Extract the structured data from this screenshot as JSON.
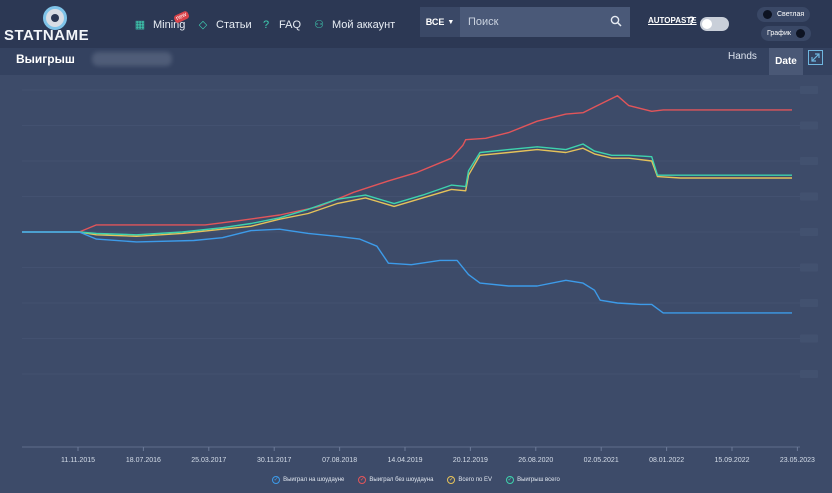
{
  "header": {
    "logo_text": "STATNAME",
    "nav": [
      {
        "label": "Mining",
        "icon": "mining-icon",
        "glyph": "▦",
        "badge": "new"
      },
      {
        "label": "Статьи",
        "icon": "diamond-icon",
        "glyph": "◇"
      },
      {
        "label": "FAQ",
        "icon": "help-circle-icon",
        "glyph": "?"
      },
      {
        "label": "Мой аккаунт",
        "icon": "user-icon",
        "glyph": "⚇"
      }
    ],
    "search": {
      "scope": "ВСЕ",
      "placeholder": "Поиск",
      "value": ""
    },
    "autopaste_label": "AUTOPASTE",
    "help_glyph": "?",
    "theme_label": "Светлая",
    "chart_label": "График"
  },
  "subheader": {
    "title": "Выигрыш",
    "hands_label": "Hands",
    "date_label": "Date"
  },
  "colors": {
    "blue": "#3d9be9",
    "red": "#e2555a",
    "yellow": "#e5c25a",
    "green": "#3ed3ad",
    "accent": "#3fd0b3"
  },
  "chart_data": {
    "type": "line",
    "x_ticks": [
      "11.11.2015",
      "18.07.2016",
      "25.03.2017",
      "30.11.2017",
      "07.08.2018",
      "14.04.2019",
      "20.12.2019",
      "26.08.2020",
      "02.05.2021",
      "08.01.2022",
      "15.09.2022",
      "23.05.2023",
      "28.01.2024",
      "04.10.2024"
    ],
    "x_range": [
      0,
      13.45
    ],
    "y_range": [
      -10,
      10
    ],
    "grid": true,
    "legend_position": "bottom",
    "series": [
      {
        "name": "Выиграл без шоудауна",
        "color": "#e2555a",
        "points": [
          [
            0,
            0
          ],
          [
            1.0,
            0
          ],
          [
            1.3,
            0.5
          ],
          [
            2.3,
            0.5
          ],
          [
            3.2,
            0.5
          ],
          [
            3.8,
            0.8
          ],
          [
            4.5,
            1.2
          ],
          [
            5.2,
            1.8
          ],
          [
            5.8,
            2.8
          ],
          [
            6.4,
            3.6
          ],
          [
            6.9,
            4.2
          ],
          [
            7.5,
            5.2
          ],
          [
            7.7,
            6.1
          ],
          [
            7.75,
            6.5
          ],
          [
            8.1,
            6.6
          ],
          [
            8.5,
            7.0
          ],
          [
            9.0,
            7.8
          ],
          [
            9.5,
            8.3
          ],
          [
            9.8,
            8.4
          ],
          [
            10.0,
            8.8
          ],
          [
            10.2,
            9.2
          ],
          [
            10.4,
            9.6
          ],
          [
            10.6,
            8.9
          ],
          [
            11.0,
            8.5
          ],
          [
            11.2,
            8.6
          ],
          [
            12.0,
            8.6
          ],
          [
            13.45,
            8.6
          ]
        ]
      },
      {
        "name": "Всего по EV",
        "color": "#e5c25a",
        "points": [
          [
            0,
            0
          ],
          [
            1.0,
            0
          ],
          [
            1.3,
            -0.2
          ],
          [
            2.0,
            -0.3
          ],
          [
            2.8,
            -0.1
          ],
          [
            3.5,
            0.2
          ],
          [
            4.0,
            0.4
          ],
          [
            4.5,
            0.9
          ],
          [
            5.0,
            1.3
          ],
          [
            5.5,
            2.0
          ],
          [
            6.0,
            2.4
          ],
          [
            6.5,
            1.8
          ],
          [
            7.0,
            2.4
          ],
          [
            7.5,
            3.0
          ],
          [
            7.75,
            2.9
          ],
          [
            7.8,
            4.0
          ],
          [
            8.0,
            5.4
          ],
          [
            8.5,
            5.6
          ],
          [
            9.0,
            5.8
          ],
          [
            9.5,
            5.6
          ],
          [
            9.8,
            5.9
          ],
          [
            10.0,
            5.5
          ],
          [
            10.3,
            5.2
          ],
          [
            10.6,
            5.2
          ],
          [
            11.0,
            5.0
          ],
          [
            11.1,
            3.9
          ],
          [
            11.5,
            3.8
          ],
          [
            12.0,
            3.8
          ],
          [
            13.45,
            3.8
          ]
        ]
      },
      {
        "name": "Выигрыш всего",
        "color": "#3ed3ad",
        "points": [
          [
            0,
            0
          ],
          [
            1.0,
            0
          ],
          [
            1.3,
            -0.1
          ],
          [
            2.0,
            -0.2
          ],
          [
            2.8,
            0
          ],
          [
            3.5,
            0.3
          ],
          [
            4.0,
            0.6
          ],
          [
            4.5,
            1.0
          ],
          [
            5.0,
            1.6
          ],
          [
            5.5,
            2.3
          ],
          [
            6.0,
            2.6
          ],
          [
            6.5,
            2.0
          ],
          [
            7.0,
            2.6
          ],
          [
            7.5,
            3.3
          ],
          [
            7.75,
            3.2
          ],
          [
            7.8,
            4.3
          ],
          [
            8.0,
            5.6
          ],
          [
            8.5,
            5.8
          ],
          [
            9.0,
            6.0
          ],
          [
            9.5,
            5.8
          ],
          [
            9.8,
            6.2
          ],
          [
            10.0,
            5.7
          ],
          [
            10.3,
            5.4
          ],
          [
            10.6,
            5.4
          ],
          [
            11.0,
            5.3
          ],
          [
            11.1,
            4.0
          ],
          [
            11.5,
            4.0
          ],
          [
            12.0,
            4.0
          ],
          [
            13.45,
            4.0
          ]
        ]
      },
      {
        "name": "Выиграл на шоудауне",
        "color": "#3d9be9",
        "points": [
          [
            0,
            0
          ],
          [
            1.0,
            0
          ],
          [
            1.3,
            -0.5
          ],
          [
            2.0,
            -0.7
          ],
          [
            3.0,
            -0.6
          ],
          [
            3.5,
            -0.4
          ],
          [
            4.0,
            0.1
          ],
          [
            4.5,
            0.2
          ],
          [
            5.0,
            -0.1
          ],
          [
            5.5,
            -0.3
          ],
          [
            5.9,
            -0.5
          ],
          [
            6.2,
            -1.0
          ],
          [
            6.4,
            -2.2
          ],
          [
            6.8,
            -2.3
          ],
          [
            7.3,
            -2.0
          ],
          [
            7.6,
            -2.0
          ],
          [
            7.8,
            -3.0
          ],
          [
            8.0,
            -3.6
          ],
          [
            8.5,
            -3.8
          ],
          [
            9.0,
            -3.8
          ],
          [
            9.5,
            -3.4
          ],
          [
            9.8,
            -3.6
          ],
          [
            10.0,
            -4.1
          ],
          [
            10.1,
            -4.8
          ],
          [
            10.4,
            -5.0
          ],
          [
            10.8,
            -5.1
          ],
          [
            11.0,
            -5.1
          ],
          [
            11.2,
            -5.7
          ],
          [
            12.0,
            -5.7
          ],
          [
            13.45,
            -5.7
          ]
        ]
      }
    ],
    "legend_marks": [
      "✓",
      "✓",
      "✓",
      "✓"
    ]
  }
}
